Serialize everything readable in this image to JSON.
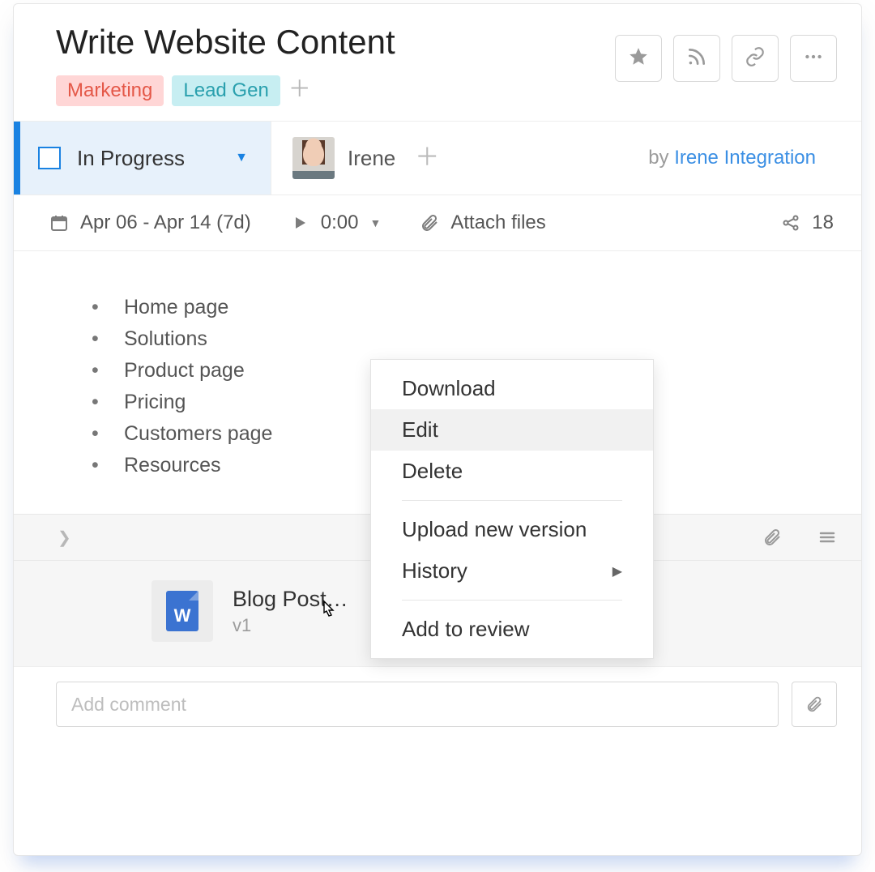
{
  "header": {
    "title": "Write Website Content",
    "tags": [
      {
        "label": "Marketing",
        "style": "marketing"
      },
      {
        "label": "Lead Gen",
        "style": "leadgen"
      }
    ]
  },
  "status": {
    "label": "In Progress"
  },
  "assignee": {
    "name": "Irene"
  },
  "creator": {
    "prefix": "by ",
    "name": "Irene Integration"
  },
  "meta": {
    "dates": "Apr 06 - Apr 14 (7d)",
    "timer": "0:00",
    "attach_label": "Attach files",
    "dependency_count": "18"
  },
  "body_items": [
    "Home page",
    "Solutions",
    "Product page",
    "Pricing",
    "Customers page",
    "Resources"
  ],
  "attachment": {
    "name": "Blog Post…",
    "version": "v1",
    "icon_letter": "W"
  },
  "comment": {
    "placeholder": "Add comment"
  },
  "context_menu": {
    "items": [
      {
        "label": "Download",
        "hover": false
      },
      {
        "label": "Edit",
        "hover": true
      },
      {
        "label": "Delete",
        "hover": false
      }
    ],
    "group2": [
      {
        "label": "Upload new version",
        "submenu": false
      },
      {
        "label": "History",
        "submenu": true
      }
    ],
    "group3": [
      {
        "label": "Add to review"
      }
    ]
  }
}
